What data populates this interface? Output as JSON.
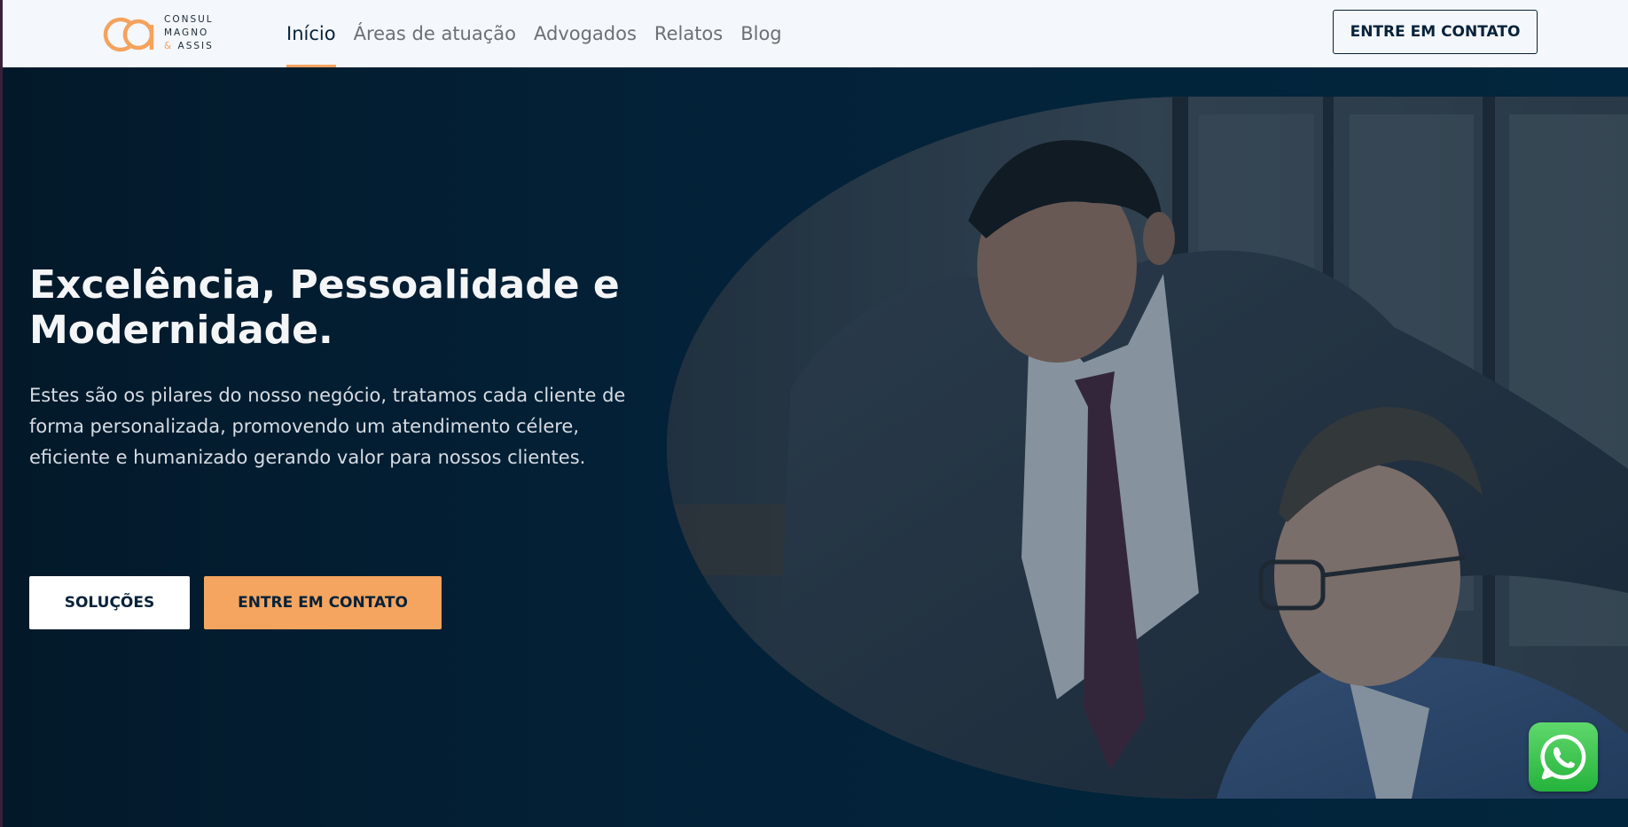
{
  "brand": {
    "line1": "CONSUL",
    "line2": "MAGNO",
    "amp": "&",
    "line3": "ASSIS",
    "accent_color": "#f5a25d"
  },
  "nav": {
    "items": [
      {
        "label": "Início",
        "active": true
      },
      {
        "label": "Áreas de atuação",
        "active": false
      },
      {
        "label": "Advogados",
        "active": false
      },
      {
        "label": "Relatos",
        "active": false
      },
      {
        "label": "Blog",
        "active": false
      }
    ]
  },
  "header": {
    "cta_label": "ENTRE EM CONTATO"
  },
  "hero": {
    "title": "Excelência, Pessoalidade e Modernidade.",
    "description": "Estes são os pilares do nosso negócio, tratamos cada cliente de forma personalizada, promovendo um atendimento célere, eficiente e humanizado gerando valor para nossos clientes.",
    "btn_solutions": "SOLUÇÕES",
    "btn_contact": "ENTRE EM CONTATO",
    "image_icon": "photo-two-businessmen"
  },
  "floating": {
    "whatsapp_icon": "whatsapp-icon",
    "whatsapp_color": "#25d366"
  },
  "colors": {
    "navy": "#07223a",
    "orange": "#f5a55f",
    "header_bg": "#f4f7fb"
  }
}
